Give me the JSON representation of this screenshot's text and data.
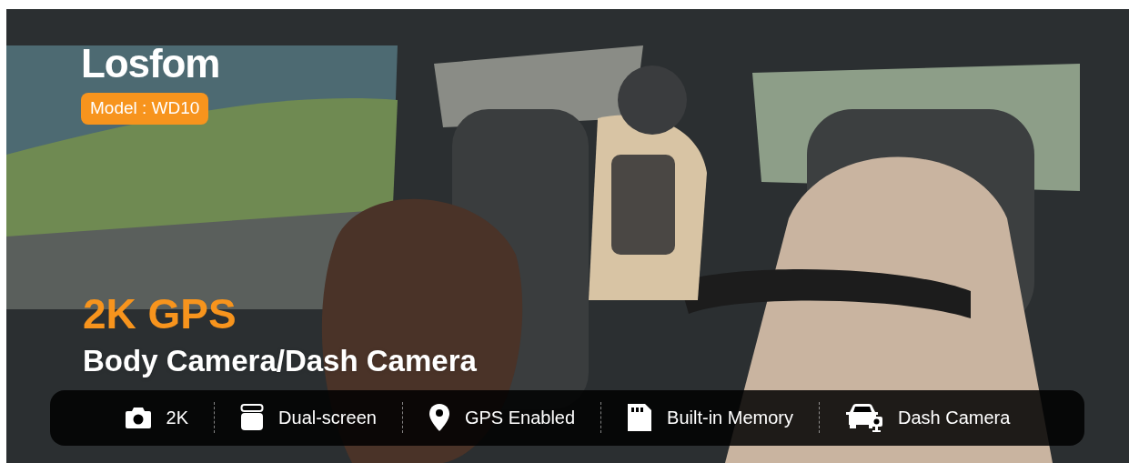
{
  "banner": {
    "kind": "picture",
    "brand": "Losfom",
    "model_badge": "Model : WD10",
    "headline": "2K GPS",
    "subheadline": "Body Camera/Dash Camera",
    "features": [
      {
        "kind": "camera",
        "label": "2K"
      },
      {
        "kind": "screen",
        "label": "Dual-screen"
      },
      {
        "kind": "pin",
        "label": "GPS Enabled"
      },
      {
        "kind": "card",
        "label": "Built-in Memory"
      },
      {
        "kind": "car",
        "label": "Dash Camera"
      }
    ]
  }
}
